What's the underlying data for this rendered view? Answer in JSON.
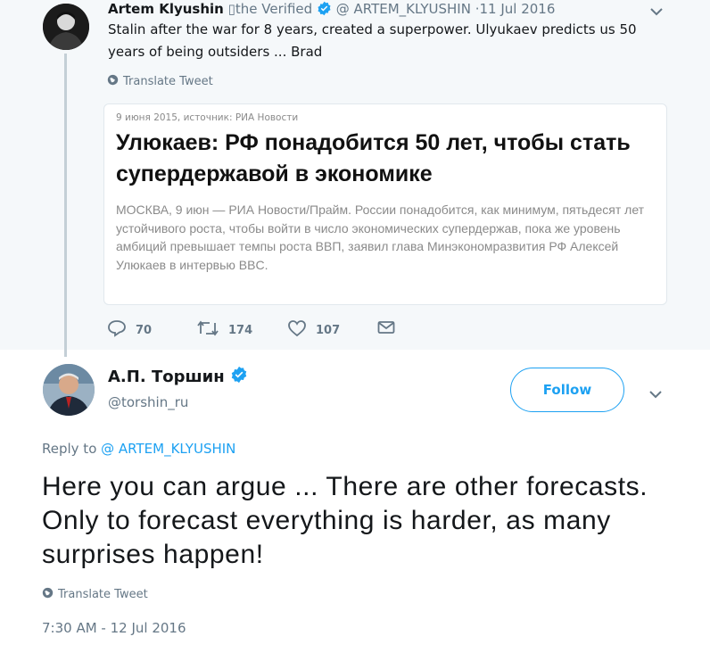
{
  "parent_tweet": {
    "name": "Artem Klyushin",
    "badge_text": "▯the Verified",
    "handle": "@ ARTEM_KLYUSHIN",
    "date": "·11 Jul 2016",
    "text": "Stalin after the war for 8 years, created a superpower. Ulyukaev predicts us 50 years of being outsiders ... Brad",
    "translate_label": "Translate Tweet",
    "quoted": {
      "date_source": "9 июня 2015, источник: РИА Новости",
      "headline": "Улюкаев: РФ понадобится 50 лет, чтобы стать супердержавой в экономике",
      "body": "МОСКВА, 9 июн — РИА Новости/Прайм. России понадобится, как минимум, пятьдесят лет устойчивого роста, чтобы войти в число экономических супердержав, пока же уровень амбиций превышает темпы роста ВВП, заявил глава Минэкономразвития РФ Алексей Улюкаев в интервью BBC."
    },
    "actions": {
      "replies": "70",
      "retweets": "174",
      "likes": "107"
    }
  },
  "reply_tweet": {
    "name": "А.П. Торшин",
    "handle": "@torshin_ru",
    "follow_label": "Follow",
    "reply_to_prefix": "Reply to",
    "reply_to_handle": "@ ARTEM_KLYUSHIN",
    "text": "Here you can argue ... There are other forecasts. Only to forecast everything is harder, as many surprises happen!",
    "translate_label": "Translate Tweet",
    "timestamp": "7:30 AM - 12 Jul 2016"
  },
  "colors": {
    "accent": "#1da1f2",
    "muted": "#657786",
    "parent_bg": "#f5f8fa",
    "thread_line": "#c4cfd6"
  },
  "icons": {
    "verified": "verified-badge-icon",
    "globe": "globe-icon",
    "reply": "reply-icon",
    "retweet": "retweet-icon",
    "like": "heart-icon",
    "dm": "envelope-icon",
    "caret": "chevron-down-icon"
  }
}
